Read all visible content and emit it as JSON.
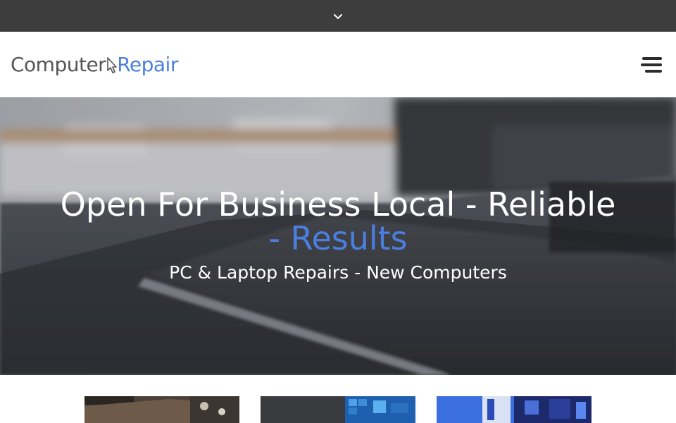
{
  "topbar": {
    "toggle_icon": "chevron-down-icon",
    "background": "#3d3d3d"
  },
  "header": {
    "logo": {
      "part1": "Computer",
      "part2": "Repair",
      "icon": "cursor-arrow-icon",
      "accent": "#4a7fe0"
    },
    "menu_icon": "hamburger-menu-icon"
  },
  "hero": {
    "title_main": "Open For Business Local - Reliable ",
    "title_accent": "- Results",
    "subtitle": "PC & Laptop Repairs - New Computers",
    "background_image": "blurred-keyboard-and-monitor-photo"
  },
  "cards": [
    {
      "image": "laptop-repair-photo"
    },
    {
      "image": "windows-desktop-photo"
    },
    {
      "image": "gaming-pc-interior-photo"
    }
  ],
  "colors": {
    "accent": "#4a7fe0",
    "text_dark": "#555555"
  }
}
